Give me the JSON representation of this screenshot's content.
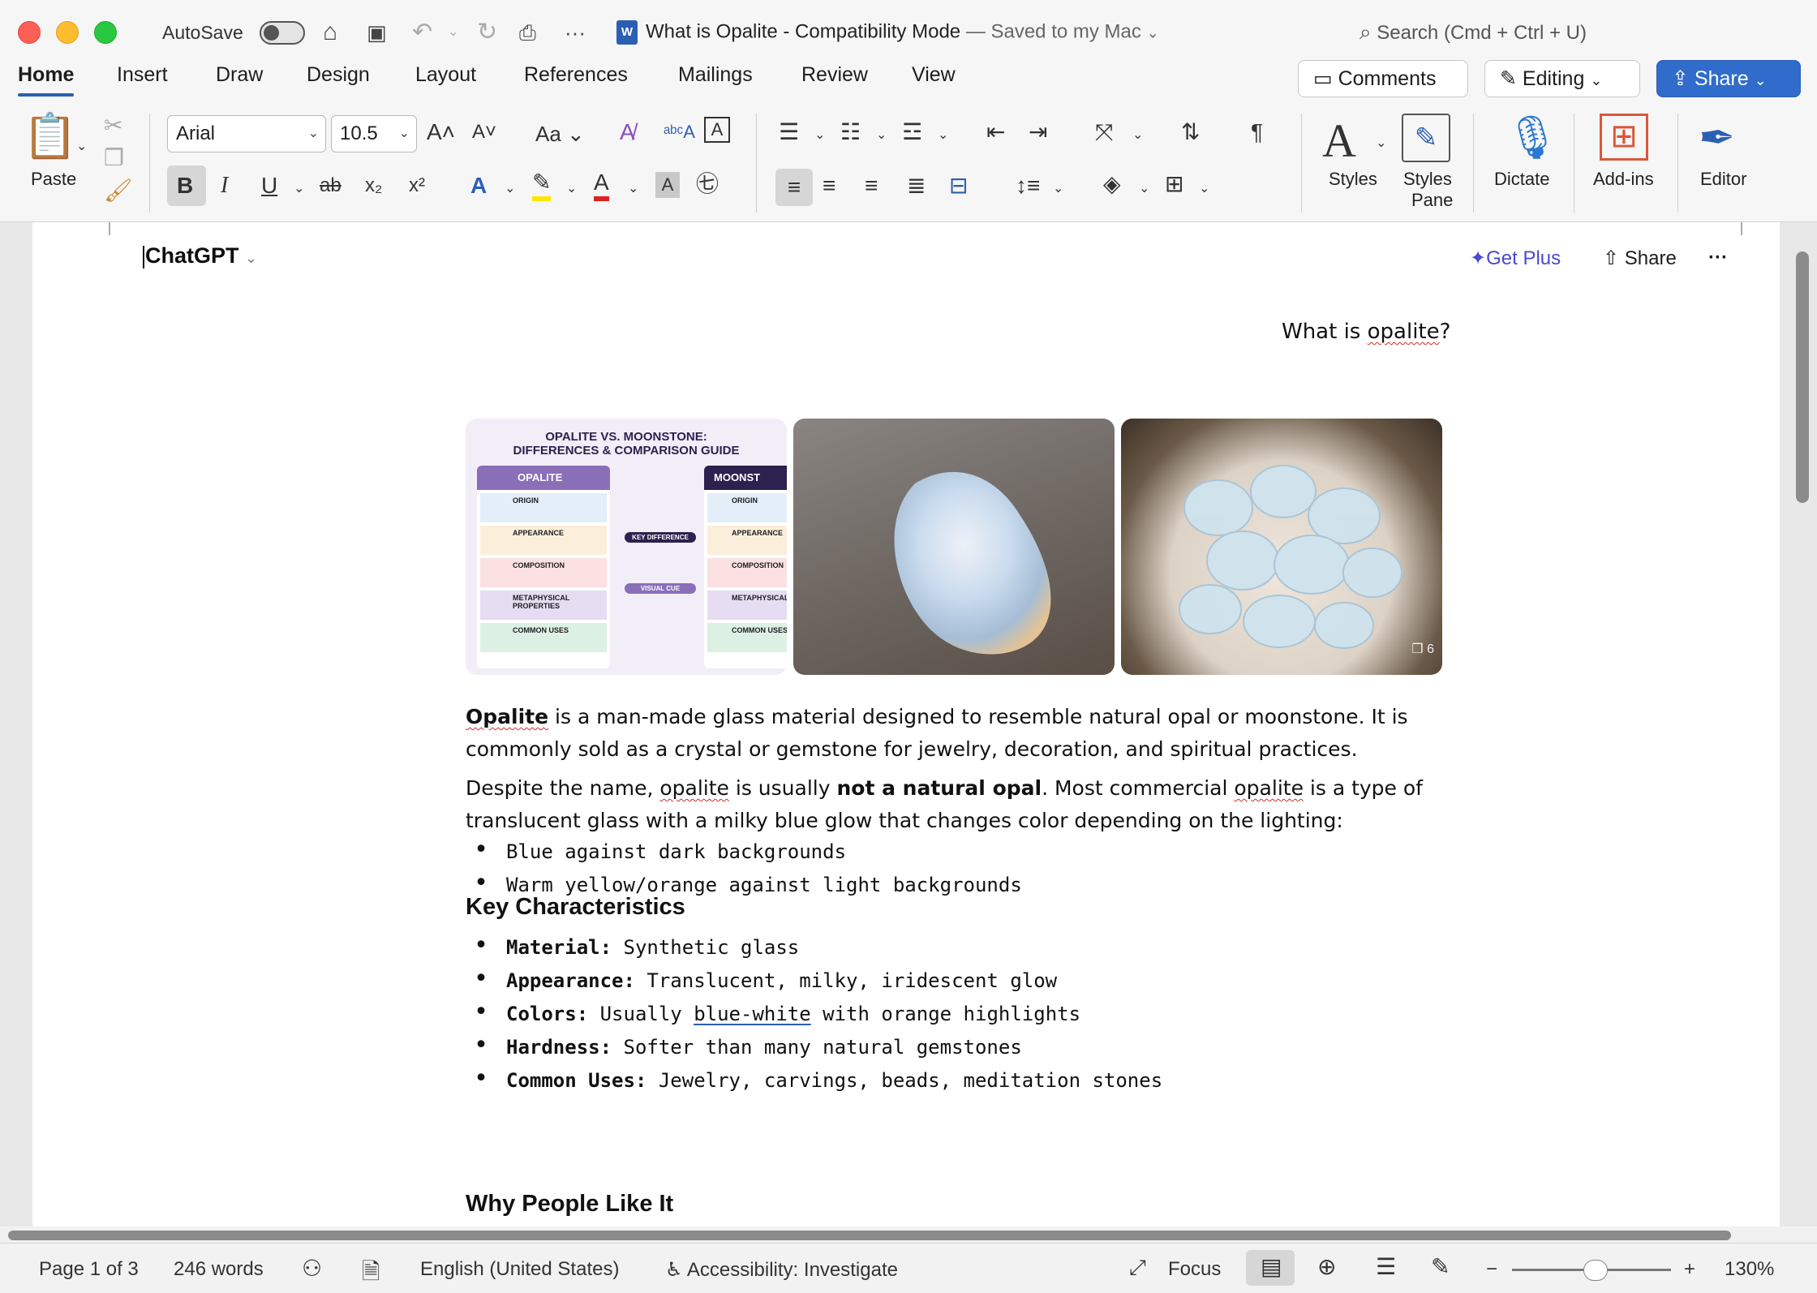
{
  "titlebar": {
    "autosave_label": "AutoSave",
    "document_title": "What is Opalite  -  Compatibility Mode",
    "save_status": "— Saved to my Mac",
    "search_placeholder": "Search (Cmd + Ctrl + U)"
  },
  "ribbon_tabs": [
    "Home",
    "Insert",
    "Draw",
    "Design",
    "Layout",
    "References",
    "Mailings",
    "Review",
    "View"
  ],
  "top_buttons": {
    "comments": "Comments",
    "editing": "Editing",
    "share": "Share"
  },
  "ribbon": {
    "paste_label": "Paste",
    "font_name": "Arial",
    "font_size": "10.5",
    "styles_label": "Styles",
    "styles_pane_label_1": "Styles",
    "styles_pane_label_2": "Pane",
    "dictate_label": "Dictate",
    "addins_label": "Add-ins",
    "editor_label": "Editor",
    "case_label": "Aa",
    "bold": "B",
    "italic": "I",
    "underline": "U",
    "strike": "ab",
    "subscript": "x₂",
    "superscript": "x²",
    "pilcrow": "¶",
    "accent_color": "#2b5fb3"
  },
  "chatgpt_header": {
    "title": "ChatGPT",
    "get_plus": "Get Plus",
    "share": "Share",
    "more": "···"
  },
  "document": {
    "question": "What is opalite?",
    "images": {
      "infographic_title_1": "OPALITE VS. MOONSTONE:",
      "infographic_title_2": "DIFFERENCES & COMPARISON GUIDE",
      "col_left": "OPALITE",
      "col_right": "MOONST",
      "left_rows": [
        "ORIGIN",
        "APPEARANCE",
        "COMPOSITION",
        "METAPHYSICAL PROPERTIES",
        "COMMON USES"
      ],
      "right_rows": [
        "ORIGIN",
        "APPEARANCE",
        "COMPOSITION",
        "METAPHYSICAL",
        "COMMON USES"
      ],
      "mid_label_1": "KEY DIFFERENCE",
      "mid_label_2": "VISUAL CUE",
      "more_count": "6"
    },
    "para1_bold": "Opalite",
    "para1_rest": " is a man-made glass material designed to resemble natural opal or moonstone. It is commonly sold as a crystal or gemstone for jewelry, decoration, and spiritual practices.",
    "para2_a": "Despite the name, ",
    "para2_opalite": "opalite",
    "para2_b": " is usually ",
    "para2_bold": "not a natural opal",
    "para2_c": ". Most commercial ",
    "para2_opalite2": "opalite",
    "para2_d": " is a type of translucent glass with a milky blue glow that changes color depending on the lighting:",
    "light_bullets": [
      "Blue against dark backgrounds",
      "Warm yellow/orange against light backgrounds"
    ],
    "heading1": "Key Characteristics",
    "characteristics": [
      {
        "key": "Material:",
        "value": " Synthetic glass"
      },
      {
        "key": "Appearance:",
        "value": " Translucent, milky, iridescent glow"
      },
      {
        "key": "Colors:",
        "value_a": " Usually ",
        "value_link": "blue-white",
        "value_b": " with orange highlights"
      },
      {
        "key": "Hardness:",
        "value": " Softer than many natural gemstones"
      },
      {
        "key": "Common Uses:",
        "value": " Jewelry, carvings, beads, meditation stones"
      }
    ],
    "heading2": "Why People Like It"
  },
  "statusbar": {
    "page": "Page 1 of 3",
    "words": "246 words",
    "language": "English (United States)",
    "accessibility": "Accessibility: Investigate",
    "focus": "Focus",
    "zoom_minus": "−",
    "zoom_plus": "+",
    "zoom": "130%",
    "zoom_level_fraction": 0.45
  }
}
